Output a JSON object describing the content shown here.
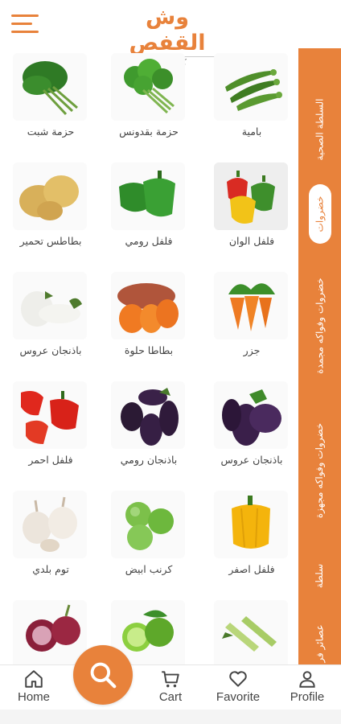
{
  "app": {
    "logo_title": "وش القفص",
    "logo_tagline": "كلها طازة",
    "accent_color": "#E8823B"
  },
  "categories": [
    {
      "label": "السلطة الصحية",
      "active": false
    },
    {
      "label": "خضروات",
      "active": true
    },
    {
      "label": "خضروات وفواكه مجمدة",
      "active": false
    },
    {
      "label": "خضروات وفواكه مجهزة",
      "active": false
    },
    {
      "label": "سلطة",
      "active": false
    },
    {
      "label": "عصائر فر",
      "active": false
    }
  ],
  "products": [
    {
      "name": "بامية",
      "icon": "okra-image"
    },
    {
      "name": "حزمة بقدونس",
      "icon": "parsley-image"
    },
    {
      "name": "حزمة شبت",
      "icon": "dill-image"
    },
    {
      "name": "فلفل الوان",
      "icon": "colored-peppers-image"
    },
    {
      "name": "فلفل رومي",
      "icon": "green-pepper-image"
    },
    {
      "name": "بطاطس تحمير",
      "icon": "potatoes-image"
    },
    {
      "name": "جزر",
      "icon": "carrots-image"
    },
    {
      "name": "بطاطا حلوة",
      "icon": "sweet-potato-image"
    },
    {
      "name": "باذنجان عروس",
      "icon": "white-eggplant-image"
    },
    {
      "name": "باذنجان عروس",
      "icon": "purple-eggplant-image"
    },
    {
      "name": "باذنجان رومي",
      "icon": "eggplant-image"
    },
    {
      "name": "فلفل احمر",
      "icon": "red-pepper-image"
    },
    {
      "name": "فلفل اصفر",
      "icon": "yellow-pepper-image"
    },
    {
      "name": "كرنب ابيض",
      "icon": "brussels-sprouts-image"
    },
    {
      "name": "توم بلدي",
      "icon": "garlic-image"
    },
    {
      "name": "",
      "icon": "zucchini-image"
    },
    {
      "name": "",
      "icon": "lime-image"
    },
    {
      "name": "",
      "icon": "red-onion-image"
    }
  ],
  "nav": {
    "home": "Home",
    "cart": "Cart",
    "favorite": "Favorite",
    "profile": "Profile"
  }
}
